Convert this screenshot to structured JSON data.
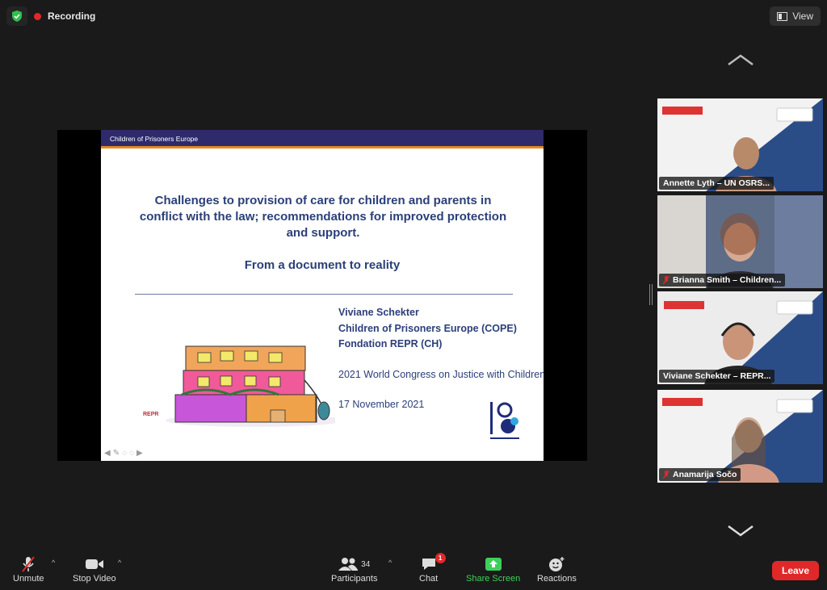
{
  "recording": {
    "label": "Recording"
  },
  "view_button": {
    "label": "View"
  },
  "slide": {
    "header": "Children of Prisoners Europe",
    "title": "Challenges to provision of care for children and parents in conflict with the law; recommendations for improved protection and support.",
    "subtitle": "From a document to reality",
    "speaker_lines": [
      "Viviane Schekter",
      "Children of Prisoners Europe (COPE)",
      "Fondation REPR (CH)"
    ],
    "congress": "2021 World Congress on Justice with Children",
    "date": "17 November 2021",
    "repr_logo": "REPR"
  },
  "participants": [
    {
      "name": "Annette Lyth – UN OSRS...",
      "bg": "#7f9ab5"
    },
    {
      "name": "Brianna Smith – Children...",
      "bg": "#9aa6b8"
    },
    {
      "name": "Viviane Schekter – REPR...",
      "bg": "#c7c1b8",
      "active": true
    },
    {
      "name": "Anamarija Sočo",
      "bg": "#b0b8c2"
    }
  ],
  "toolbar": {
    "unmute": "Unmute",
    "stop_video": "Stop Video",
    "participants": "Participants",
    "participants_count": "34",
    "chat": "Chat",
    "chat_badge": "1",
    "share_screen": "Share Screen",
    "reactions": "Reactions",
    "leave": "Leave"
  },
  "colors": {
    "accent_green": "#3ecf5a",
    "leave_red": "#e02828",
    "active_border": "#b8e02d",
    "slide_blue": "#2b3f79"
  }
}
